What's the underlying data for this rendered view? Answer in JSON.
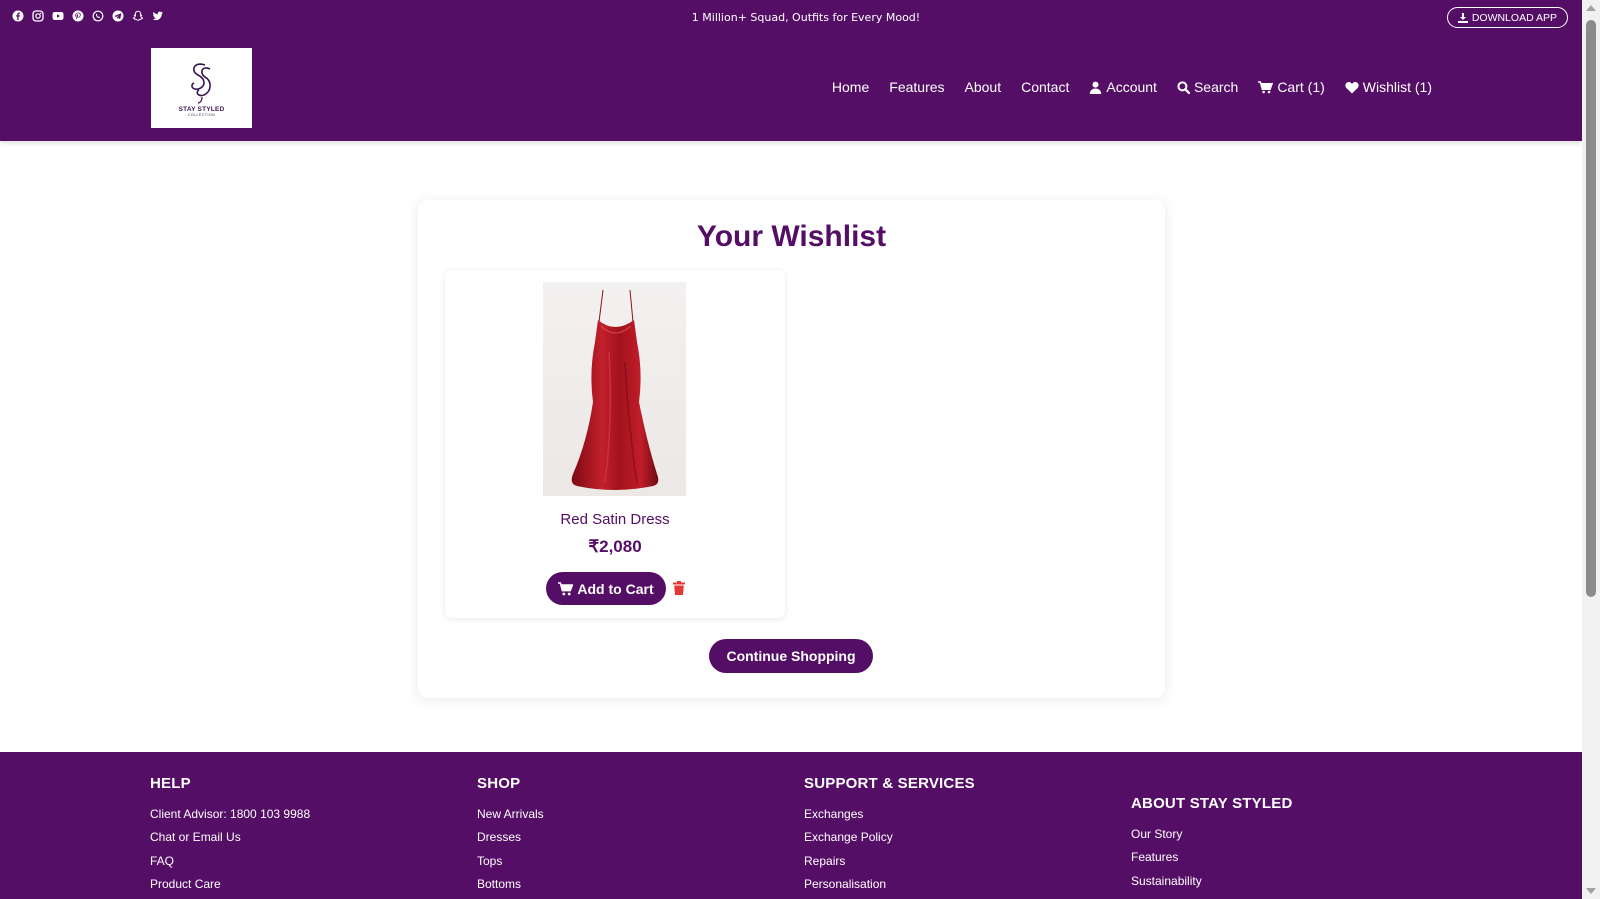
{
  "topbar": {
    "social_icons": [
      "facebook-icon",
      "instagram-icon",
      "youtube-icon",
      "pinterest-icon",
      "whatsapp-icon",
      "telegram-icon",
      "snapchat-icon",
      "twitter-icon"
    ],
    "promo": "1 Million+ Squad, Outfits for Every Mood!",
    "download_label": "DOWNLOAD APP"
  },
  "header": {
    "logo_text": "STAY STYLED",
    "logo_subtext": "COLLECTION",
    "nav": {
      "home": "Home",
      "features": "Features",
      "about": "About",
      "contact": "Contact",
      "account": "Account",
      "search": "Search",
      "cart": "Cart (1)",
      "wishlist": "Wishlist (1)"
    }
  },
  "wishlist": {
    "title": "Your Wishlist",
    "items": [
      {
        "name": "Red Satin Dress",
        "price": "₹2,080",
        "add_label": "Add to Cart"
      }
    ],
    "continue_label": "Continue Shopping"
  },
  "footer": {
    "help": {
      "title": "HELP",
      "links": [
        "Client Advisor: 1800 103 9988",
        "Chat or Email Us",
        "FAQ",
        "Product Care"
      ]
    },
    "shop": {
      "title": "SHOP",
      "links": [
        "New Arrivals",
        "Dresses",
        "Tops",
        "Bottoms"
      ]
    },
    "support": {
      "title": "SUPPORT & SERVICES",
      "links": [
        "Exchanges",
        "Exchange Policy",
        "Repairs",
        "Personalisation"
      ]
    },
    "about": {
      "title": "ABOUT STAY STYLED",
      "links": [
        "Our Story",
        "Features",
        "Sustainability"
      ]
    }
  },
  "colors": {
    "brand_purple": "#540e65",
    "white": "#ffffff",
    "trash_red": "#e53935",
    "dress_red": "#b3121f"
  }
}
